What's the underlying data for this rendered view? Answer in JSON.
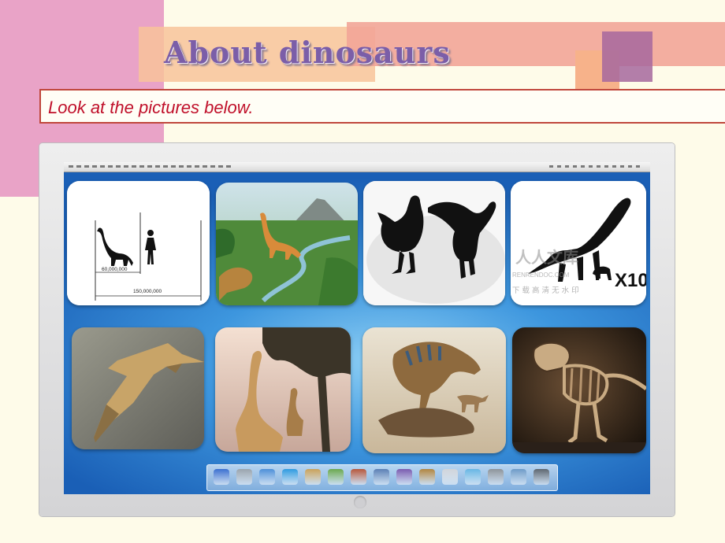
{
  "slide": {
    "title": "About dinosaurs",
    "instruction": "Look at the pictures below."
  },
  "tiles": [
    {
      "name": "scale-comparison",
      "labels": {
        "small_measure": "60,000,000",
        "large_measure": "150,000,000"
      }
    },
    {
      "name": "jungle-landscape"
    },
    {
      "name": "chicken-dinosaur-silhouettes"
    },
    {
      "name": "size-comparison-silhouette",
      "multiplier": "X10",
      "watermark": {
        "brand": "人人文库",
        "url": "RENRENDOC.COM",
        "caption": "下 载 高 清 无 水 印"
      }
    },
    {
      "name": "pterosaur"
    },
    {
      "name": "longneck-trees"
    },
    {
      "name": "t-rex-feeding"
    },
    {
      "name": "skeleton-fossil"
    }
  ],
  "colors": {
    "title": "#7b5ea8",
    "instruction_text": "#c0102a",
    "instruction_border": "#c0473c",
    "background": "#fefbe9",
    "screen": "#3d96de"
  },
  "dock_icons": [
    "finder-icon",
    "clock-icon",
    "network-icon",
    "safari-icon",
    "notes-icon",
    "music-icon",
    "photo-icon",
    "movie-icon",
    "imovie-icon",
    "guitar-icon",
    "calendar-icon",
    "globe-icon",
    "preferences-icon",
    "search-icon",
    "trash-icon"
  ]
}
